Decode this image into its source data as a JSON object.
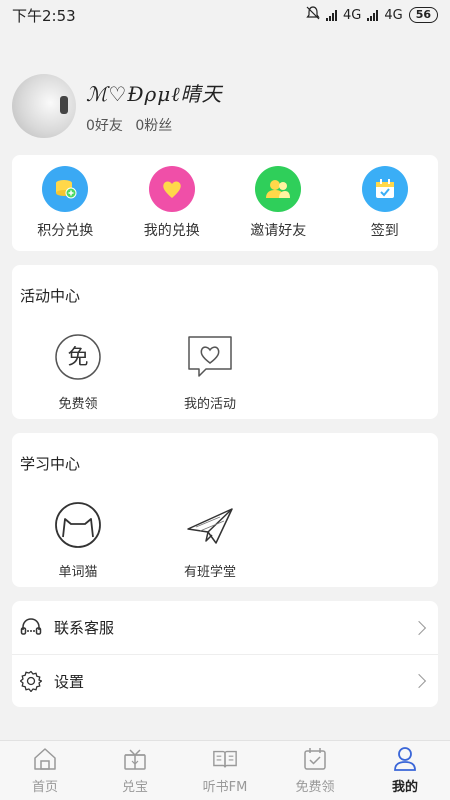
{
  "status_bar": {
    "time": "下午2:53",
    "network1": "4G",
    "network2": "4G",
    "battery": "56"
  },
  "profile": {
    "username": "ℳ♡Ðρμℓ晴天",
    "friends": "0好友",
    "fans": "0粉丝"
  },
  "shortcuts": [
    {
      "label": "积分兑换",
      "icon": "coins-icon",
      "color": "#3aa9f4"
    },
    {
      "label": "我的兑换",
      "icon": "heart-icon",
      "color": "#f04fa8"
    },
    {
      "label": "邀请好友",
      "icon": "friends-icon",
      "color": "#2fcf5a"
    },
    {
      "label": "签到",
      "icon": "calendar-icon",
      "color": "#3aaef6"
    }
  ],
  "activity": {
    "title": "活动中心",
    "items": [
      {
        "label": "免费领",
        "icon": "free-icon",
        "glyph": "免"
      },
      {
        "label": "我的活动",
        "icon": "chat-heart-icon"
      }
    ]
  },
  "study": {
    "title": "学习中心",
    "items": [
      {
        "label": "单词猫",
        "icon": "cat-icon"
      },
      {
        "label": "有班学堂",
        "icon": "paper-plane-icon"
      }
    ]
  },
  "menu": [
    {
      "label": "联系客服",
      "icon": "headset-icon"
    },
    {
      "label": "设置",
      "icon": "gear-icon"
    }
  ],
  "tabs": [
    {
      "label": "首页",
      "icon": "home-icon"
    },
    {
      "label": "兑宝",
      "icon": "gift-icon"
    },
    {
      "label": "听书FM",
      "icon": "book-icon"
    },
    {
      "label": "免费领",
      "icon": "calendar-check-icon"
    },
    {
      "label": "我的",
      "icon": "user-icon",
      "active": true
    }
  ]
}
